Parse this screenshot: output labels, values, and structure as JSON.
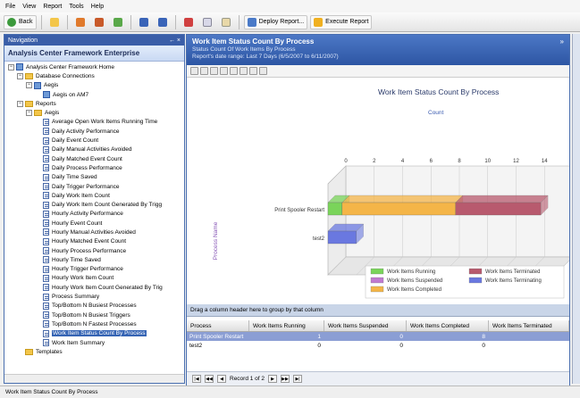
{
  "menu": [
    "File",
    "View",
    "Report",
    "Tools",
    "Help"
  ],
  "toolbar": {
    "back_label": "Back",
    "deploy_label": "Deploy Report...",
    "execute_label": "Execute Report"
  },
  "nav": {
    "header": "Navigation",
    "pin": "← ×",
    "title": "Analysis Center Framework Enterprise",
    "tree": [
      {
        "label": "Analysis Center Framework Home",
        "indent": 0,
        "exp": "−",
        "icon": "home"
      },
      {
        "label": "Database Connections",
        "indent": 1,
        "exp": "−",
        "icon": "folder"
      },
      {
        "label": "Aegis",
        "indent": 2,
        "exp": "−",
        "icon": "db"
      },
      {
        "label": "Aegis on AM7",
        "indent": 3,
        "exp": "",
        "icon": "db"
      },
      {
        "label": "Reports",
        "indent": 1,
        "exp": "−",
        "icon": "folder"
      },
      {
        "label": "Aegis",
        "indent": 2,
        "exp": "−",
        "icon": "folder"
      },
      {
        "label": "Average Open Work Items Running Time",
        "indent": 3,
        "exp": "",
        "icon": "report"
      },
      {
        "label": "Daily Activity Performance",
        "indent": 3,
        "exp": "",
        "icon": "report"
      },
      {
        "label": "Daily Event Count",
        "indent": 3,
        "exp": "",
        "icon": "report"
      },
      {
        "label": "Daily Manual Activities Avoided",
        "indent": 3,
        "exp": "",
        "icon": "report"
      },
      {
        "label": "Daily Matched Event Count",
        "indent": 3,
        "exp": "",
        "icon": "report"
      },
      {
        "label": "Daily Process Performance",
        "indent": 3,
        "exp": "",
        "icon": "report"
      },
      {
        "label": "Daily Time Saved",
        "indent": 3,
        "exp": "",
        "icon": "report"
      },
      {
        "label": "Daily Trigger Performance",
        "indent": 3,
        "exp": "",
        "icon": "report"
      },
      {
        "label": "Daily Work Item Count",
        "indent": 3,
        "exp": "",
        "icon": "report"
      },
      {
        "label": "Daily Work Item Count Generated By Trigg",
        "indent": 3,
        "exp": "",
        "icon": "report"
      },
      {
        "label": "Hourly Activity Performance",
        "indent": 3,
        "exp": "",
        "icon": "report"
      },
      {
        "label": "Hourly Event Count",
        "indent": 3,
        "exp": "",
        "icon": "report"
      },
      {
        "label": "Hourly Manual Activities Avoided",
        "indent": 3,
        "exp": "",
        "icon": "report"
      },
      {
        "label": "Hourly Matched Event Count",
        "indent": 3,
        "exp": "",
        "icon": "report"
      },
      {
        "label": "Hourly Process Performance",
        "indent": 3,
        "exp": "",
        "icon": "report"
      },
      {
        "label": "Hourly Time Saved",
        "indent": 3,
        "exp": "",
        "icon": "report"
      },
      {
        "label": "Hourly Trigger Performance",
        "indent": 3,
        "exp": "",
        "icon": "report"
      },
      {
        "label": "Hourly Work Item Count",
        "indent": 3,
        "exp": "",
        "icon": "report"
      },
      {
        "label": "Hourly Work Item Count Generated By Trig",
        "indent": 3,
        "exp": "",
        "icon": "report"
      },
      {
        "label": "Process Summary",
        "indent": 3,
        "exp": "",
        "icon": "report"
      },
      {
        "label": "Top/Bottom N Busiest Processes",
        "indent": 3,
        "exp": "",
        "icon": "report"
      },
      {
        "label": "Top/Bottom N Busiest Triggers",
        "indent": 3,
        "exp": "",
        "icon": "report"
      },
      {
        "label": "Top/Bottom N Fastest Processes",
        "indent": 3,
        "exp": "",
        "icon": "report"
      },
      {
        "label": "Work Item Status Count By Process",
        "indent": 3,
        "exp": "",
        "icon": "report",
        "selected": true
      },
      {
        "label": "Work Item Summary",
        "indent": 3,
        "exp": "",
        "icon": "report"
      },
      {
        "label": "Templates",
        "indent": 1,
        "exp": "",
        "icon": "folder"
      }
    ]
  },
  "main": {
    "title": "Work Item Status Count By Process",
    "subtitle": "Status Count Of Work Items By Process",
    "range": "Report's date range: Last 7 Days (6/5/2007 to 6/11/2007)",
    "star": "»"
  },
  "chart_data": {
    "type": "bar",
    "orientation": "horizontal-3d-stacked",
    "title": "Work Item Status Count By Process",
    "xlabel": "Count",
    "ylabel": "Process Name",
    "xlim": [
      0,
      16
    ],
    "xticks": [
      0,
      2,
      4,
      6,
      8,
      10,
      12,
      14,
      16
    ],
    "categories": [
      "Print Spooler Restart",
      "test2"
    ],
    "series": [
      {
        "name": "Work Items Running",
        "values": [
          1,
          0
        ],
        "color": "#7ad45a"
      },
      {
        "name": "Work Items Suspended",
        "values": [
          0,
          0
        ],
        "color": "#c07ad0"
      },
      {
        "name": "Work Items Completed",
        "values": [
          8,
          0
        ],
        "color": "#f4b548"
      },
      {
        "name": "Work Items Terminated",
        "values": [
          6,
          0
        ],
        "color": "#b85a6e"
      },
      {
        "name": "Work Items Terminating",
        "values": [
          0,
          2
        ],
        "color": "#6a78e0"
      }
    ],
    "legend_position": "bottom-right",
    "grid": true
  },
  "grid": {
    "group_hint": "Drag a column header here to group by that column",
    "columns": [
      "Process",
      "Work Items Running",
      "Work Items Suspended",
      "Work Items Completed",
      "Work Items Terminated"
    ],
    "rows": [
      [
        "Print Spooler Restart",
        "1",
        "0",
        "8",
        ""
      ],
      [
        "test2",
        "0",
        "0",
        "0",
        ""
      ]
    ],
    "pager": "Record 1 of 2"
  },
  "status": "Work Item Status Count By Process"
}
